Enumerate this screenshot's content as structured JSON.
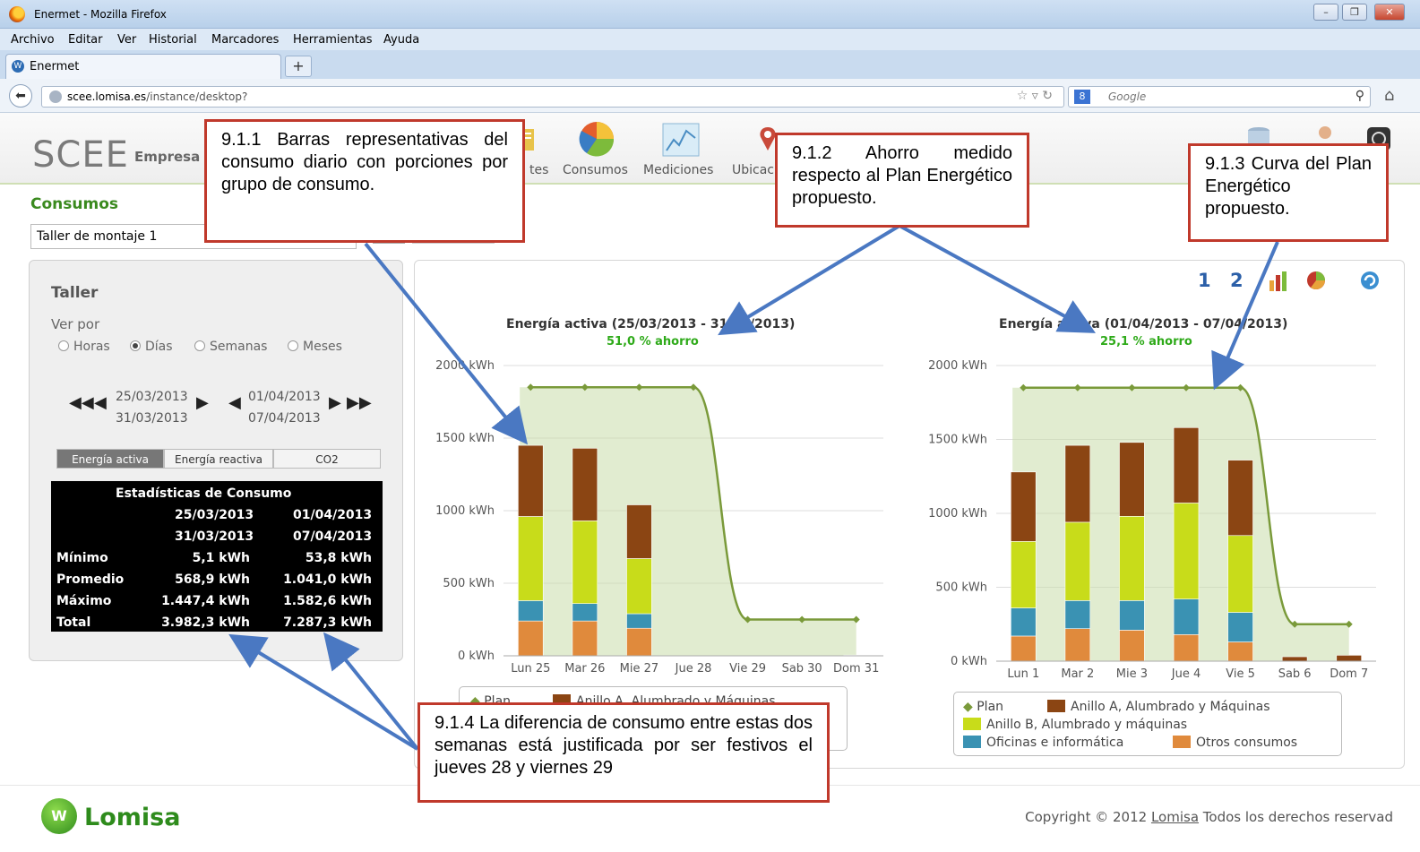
{
  "window": {
    "title": "Enermet - Mozilla Firefox"
  },
  "menu": [
    "Archivo",
    "Editar",
    "Ver",
    "Historial",
    "Marcadores",
    "Herramientas",
    "Ayuda"
  ],
  "tab": {
    "label": "Enermet",
    "new_tab": "+"
  },
  "nav": {
    "url_host": "scee.lomisa.es",
    "url_path": "/instance/desktop?",
    "search_placeholder": "Google"
  },
  "header": {
    "brand": "SCEE",
    "brand_sub": "Empresa D",
    "nav_items": [
      "tes",
      "Consumos",
      "Mediciones",
      "Ubicac"
    ]
  },
  "section": {
    "title": "Consumos",
    "selector_value": "Taller de montaje 1"
  },
  "left_panel": {
    "title": "Taller",
    "view_by": "Ver por",
    "radios": [
      {
        "label": "Horas",
        "selected": false
      },
      {
        "label": "Días",
        "selected": true
      },
      {
        "label": "Semanas",
        "selected": false
      },
      {
        "label": "Meses",
        "selected": false
      }
    ],
    "range1": {
      "start": "25/03/2013",
      "end": "31/03/2013"
    },
    "range2": {
      "start": "01/04/2013",
      "end": "07/04/2013"
    },
    "segments": [
      "Energía activa",
      "Energía reactiva",
      "CO2"
    ],
    "stats": {
      "title": "Estadísticas de Consumo",
      "header_start": [
        "25/03/2013",
        "01/04/2013"
      ],
      "header_end": [
        "31/03/2013",
        "07/04/2013"
      ],
      "rows": [
        {
          "label": "Mínimo",
          "a": "5,1 kWh",
          "b": "53,8 kWh"
        },
        {
          "label": "Promedio",
          "a": "568,9 kWh",
          "b": "1.041,0 kWh"
        },
        {
          "label": "Máximo",
          "a": "1.447,4 kWh",
          "b": "1.582,6 kWh"
        },
        {
          "label": "Total",
          "a": "3.982,3 kWh",
          "b": "7.287,3 kWh"
        }
      ]
    }
  },
  "toolbar": {
    "btn1": "1",
    "btn2": "2"
  },
  "colors": {
    "anillo_a": "#8b4513",
    "anillo_b": "#c8dc1a",
    "oficinas": "#3a92b3",
    "otros": "#e08a3c",
    "plan": "#7a9a3a"
  },
  "chart_data": [
    {
      "type": "bar",
      "title": "Energía activa (25/03/2013 - 31/03/2013)",
      "subtitle": "51,0 % ahorro",
      "categories": [
        "Lun 25",
        "Mar 26",
        "Mie 27",
        "Jue 28",
        "Vie 29",
        "Sab 30",
        "Dom 31"
      ],
      "y_ticks": [
        "0 kWh",
        "500 kWh",
        "1000 kWh",
        "1500 kWh",
        "2000 kWh"
      ],
      "ylim": [
        0,
        2000
      ],
      "stacked": true,
      "series": [
        {
          "name": "Otros consumos",
          "values": [
            240,
            240,
            190,
            0,
            0,
            0,
            5
          ]
        },
        {
          "name": "Oficinas e informática",
          "values": [
            140,
            120,
            100,
            0,
            0,
            0,
            0
          ]
        },
        {
          "name": "Anillo B, Alumbrado y máquinas",
          "values": [
            580,
            570,
            380,
            0,
            0,
            0,
            0
          ]
        },
        {
          "name": "Anillo A, Alumbrado y Máquinas",
          "values": [
            490,
            500,
            370,
            0,
            0,
            0,
            0
          ]
        }
      ],
      "plan": {
        "name": "Plan",
        "values": [
          1850,
          1850,
          1850,
          1850,
          250,
          250,
          250
        ]
      },
      "legend": [
        "Plan",
        "Anillo A, Alumbrado y Máquinas"
      ]
    },
    {
      "type": "bar",
      "title": "Energía activa (01/04/2013 - 07/04/2013)",
      "subtitle": "25,1 % ahorro",
      "categories": [
        "Lun 1",
        "Mar 2",
        "Mie 3",
        "Jue 4",
        "Vie 5",
        "Sab 6",
        "Dom 7"
      ],
      "y_ticks": [
        "0 kWh",
        "500 kWh",
        "1000 kWh",
        "1500 kWh",
        "2000 kWh"
      ],
      "ylim": [
        0,
        2000
      ],
      "stacked": true,
      "series": [
        {
          "name": "Otros consumos",
          "values": [
            170,
            220,
            210,
            180,
            130,
            0,
            0
          ]
        },
        {
          "name": "Oficinas e informática",
          "values": [
            190,
            190,
            200,
            240,
            200,
            0,
            0
          ]
        },
        {
          "name": "Anillo B, Alumbrado y máquinas",
          "values": [
            450,
            530,
            570,
            650,
            520,
            0,
            0
          ]
        },
        {
          "name": "Anillo A, Alumbrado y Máquinas",
          "values": [
            470,
            520,
            500,
            510,
            510,
            30,
            40
          ]
        }
      ],
      "plan": {
        "name": "Plan",
        "values": [
          1850,
          1850,
          1850,
          1850,
          1850,
          250,
          250
        ]
      },
      "legend": [
        "Plan",
        "Anillo A, Alumbrado y Máquinas",
        "Anillo B, Alumbrado y máquinas",
        "Oficinas e informática",
        "Otros consumos"
      ]
    }
  ],
  "annotations": {
    "a1": "9.1.1 Barras representativas del consumo diario con porciones por grupo de consumo.",
    "a2": "9.1.2 Ahorro medido respecto al Plan Energético propuesto.",
    "a3": "9.1.3 Curva del Plan Energético propuesto.",
    "a4": "9.1.4 La diferencia de consumo entre estas dos semanas está justificada por ser festivos el jueves 28 y viernes 29"
  },
  "footer": {
    "logo_text": "Lomisa",
    "copyright": "Copyright © 2012",
    "link": "Lomisa",
    "rights": "Todos los derechos reservad"
  }
}
